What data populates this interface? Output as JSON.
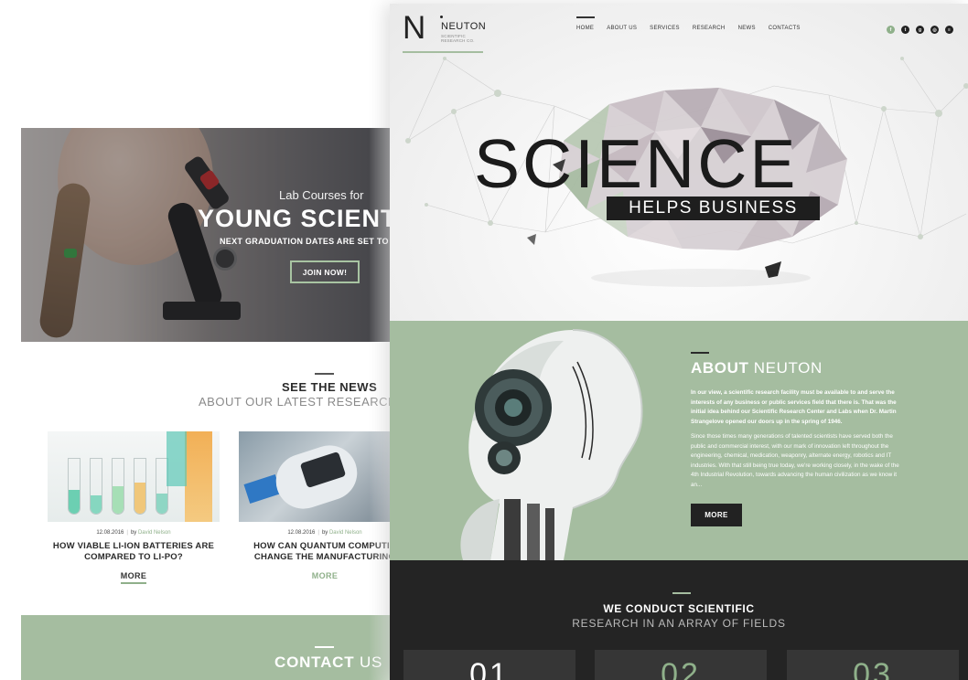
{
  "back_page": {
    "hero": {
      "kicker": "Lab Courses for",
      "title": "YOUNG SCIENT",
      "subtitle": "NEXT GRADUATION DATES ARE SET TO J",
      "cta_label": "JOIN NOW!"
    },
    "news_section": {
      "title": "SEE THE NEWS",
      "subtitle": "ABOUT OUR LATEST RESEARCH",
      "cards": [
        {
          "date": "12.08.2016",
          "by": "by",
          "author": "David Nelson",
          "heading": "HOW VIABLE LI-ION BATTERIES ARE\nCOMPARED TO LI-PO?",
          "more_label": "MORE"
        },
        {
          "date": "12.08.2016",
          "by": "by",
          "author": "David Nelson",
          "heading": "HOW CAN QUANTUM COMPUTIN\nCHANGE THE MANUFACTURING",
          "more_label": "MORE"
        }
      ]
    },
    "contact": {
      "title_bold": "CONTACT",
      "title_rest": " US"
    }
  },
  "front_page": {
    "logo": {
      "letter": "N",
      "name": "NEUTON",
      "tagline": "SCIENTIFIC RESEARCH CO."
    },
    "nav": [
      "HOME",
      "ABOUT US",
      "SERVICES",
      "RESEARCH",
      "NEWS",
      "CONTACTS"
    ],
    "nav_active_index": 0,
    "social": [
      {
        "icon": "facebook-icon",
        "glyph": "f"
      },
      {
        "icon": "twitter-icon",
        "glyph": "t"
      },
      {
        "icon": "google-plus-icon",
        "glyph": "g"
      },
      {
        "icon": "instagram-icon",
        "glyph": "◎"
      },
      {
        "icon": "rss-icon",
        "glyph": "≡"
      }
    ],
    "hero": {
      "headline": "SCIENCE",
      "tagline": "HELPS BUSINESS"
    },
    "about": {
      "title_bold": "ABOUT",
      "title_rest": " NEUTON",
      "paragraph_1": "In our view, a scientific research facility must be available to and serve the interests of any business or public services field that there is. That was the initial idea behind our Scientific Research Center and Labs when Dr. Martin Strangelove opened our doors up in the spring of 1946.",
      "paragraph_2": "Since those times many generations of talented scientists have served both the public and commercial interest, with our mark of innovation left throughout the engineering, chemical, medication, weaponry, alternate energy, robotics and IT industries. With that still being true today, we're working closely, in the wake of the 4th Industrial Revolution, towards advancing the human civilization as we know it an...",
      "more_label": "MORE"
    },
    "fields": {
      "title": "WE CONDUCT SCIENTIFIC",
      "subtitle": "RESEARCH IN AN ARRAY OF FIELDS",
      "numbers": [
        "01",
        "02",
        "03"
      ]
    }
  },
  "colors": {
    "accent_green": "#a5bda0",
    "dark": "#242424",
    "text_green": "#8fb08a"
  }
}
